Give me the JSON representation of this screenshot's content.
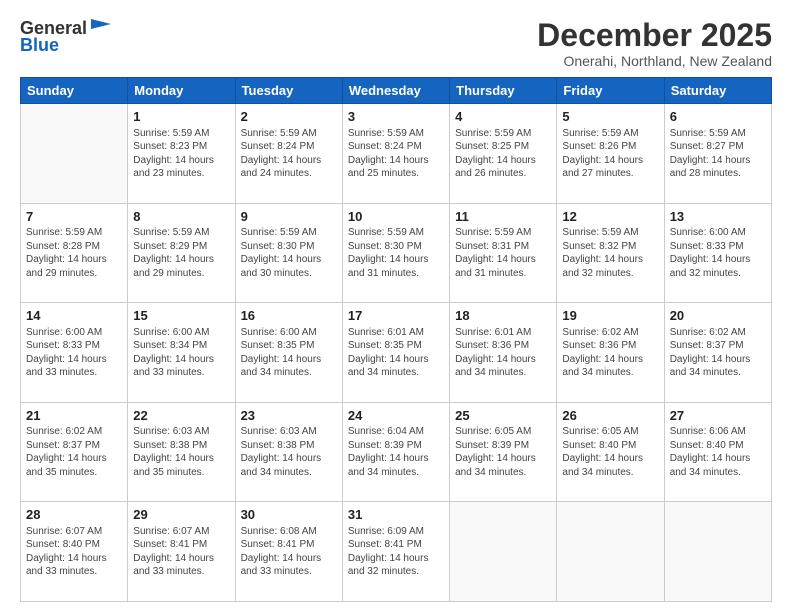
{
  "logo": {
    "general": "General",
    "blue": "Blue"
  },
  "header": {
    "title": "December 2025",
    "location": "Onerahi, Northland, New Zealand"
  },
  "weekdays": [
    "Sunday",
    "Monday",
    "Tuesday",
    "Wednesday",
    "Thursday",
    "Friday",
    "Saturday"
  ],
  "weeks": [
    [
      {
        "day": "",
        "text": ""
      },
      {
        "day": "1",
        "text": "Sunrise: 5:59 AM\nSunset: 8:23 PM\nDaylight: 14 hours\nand 23 minutes."
      },
      {
        "day": "2",
        "text": "Sunrise: 5:59 AM\nSunset: 8:24 PM\nDaylight: 14 hours\nand 24 minutes."
      },
      {
        "day": "3",
        "text": "Sunrise: 5:59 AM\nSunset: 8:24 PM\nDaylight: 14 hours\nand 25 minutes."
      },
      {
        "day": "4",
        "text": "Sunrise: 5:59 AM\nSunset: 8:25 PM\nDaylight: 14 hours\nand 26 minutes."
      },
      {
        "day": "5",
        "text": "Sunrise: 5:59 AM\nSunset: 8:26 PM\nDaylight: 14 hours\nand 27 minutes."
      },
      {
        "day": "6",
        "text": "Sunrise: 5:59 AM\nSunset: 8:27 PM\nDaylight: 14 hours\nand 28 minutes."
      }
    ],
    [
      {
        "day": "7",
        "text": "Sunrise: 5:59 AM\nSunset: 8:28 PM\nDaylight: 14 hours\nand 29 minutes."
      },
      {
        "day": "8",
        "text": "Sunrise: 5:59 AM\nSunset: 8:29 PM\nDaylight: 14 hours\nand 29 minutes."
      },
      {
        "day": "9",
        "text": "Sunrise: 5:59 AM\nSunset: 8:30 PM\nDaylight: 14 hours\nand 30 minutes."
      },
      {
        "day": "10",
        "text": "Sunrise: 5:59 AM\nSunset: 8:30 PM\nDaylight: 14 hours\nand 31 minutes."
      },
      {
        "day": "11",
        "text": "Sunrise: 5:59 AM\nSunset: 8:31 PM\nDaylight: 14 hours\nand 31 minutes."
      },
      {
        "day": "12",
        "text": "Sunrise: 5:59 AM\nSunset: 8:32 PM\nDaylight: 14 hours\nand 32 minutes."
      },
      {
        "day": "13",
        "text": "Sunrise: 6:00 AM\nSunset: 8:33 PM\nDaylight: 14 hours\nand 32 minutes."
      }
    ],
    [
      {
        "day": "14",
        "text": "Sunrise: 6:00 AM\nSunset: 8:33 PM\nDaylight: 14 hours\nand 33 minutes."
      },
      {
        "day": "15",
        "text": "Sunrise: 6:00 AM\nSunset: 8:34 PM\nDaylight: 14 hours\nand 33 minutes."
      },
      {
        "day": "16",
        "text": "Sunrise: 6:00 AM\nSunset: 8:35 PM\nDaylight: 14 hours\nand 34 minutes."
      },
      {
        "day": "17",
        "text": "Sunrise: 6:01 AM\nSunset: 8:35 PM\nDaylight: 14 hours\nand 34 minutes."
      },
      {
        "day": "18",
        "text": "Sunrise: 6:01 AM\nSunset: 8:36 PM\nDaylight: 14 hours\nand 34 minutes."
      },
      {
        "day": "19",
        "text": "Sunrise: 6:02 AM\nSunset: 8:36 PM\nDaylight: 14 hours\nand 34 minutes."
      },
      {
        "day": "20",
        "text": "Sunrise: 6:02 AM\nSunset: 8:37 PM\nDaylight: 14 hours\nand 34 minutes."
      }
    ],
    [
      {
        "day": "21",
        "text": "Sunrise: 6:02 AM\nSunset: 8:37 PM\nDaylight: 14 hours\nand 35 minutes."
      },
      {
        "day": "22",
        "text": "Sunrise: 6:03 AM\nSunset: 8:38 PM\nDaylight: 14 hours\nand 35 minutes."
      },
      {
        "day": "23",
        "text": "Sunrise: 6:03 AM\nSunset: 8:38 PM\nDaylight: 14 hours\nand 34 minutes."
      },
      {
        "day": "24",
        "text": "Sunrise: 6:04 AM\nSunset: 8:39 PM\nDaylight: 14 hours\nand 34 minutes."
      },
      {
        "day": "25",
        "text": "Sunrise: 6:05 AM\nSunset: 8:39 PM\nDaylight: 14 hours\nand 34 minutes."
      },
      {
        "day": "26",
        "text": "Sunrise: 6:05 AM\nSunset: 8:40 PM\nDaylight: 14 hours\nand 34 minutes."
      },
      {
        "day": "27",
        "text": "Sunrise: 6:06 AM\nSunset: 8:40 PM\nDaylight: 14 hours\nand 34 minutes."
      }
    ],
    [
      {
        "day": "28",
        "text": "Sunrise: 6:07 AM\nSunset: 8:40 PM\nDaylight: 14 hours\nand 33 minutes."
      },
      {
        "day": "29",
        "text": "Sunrise: 6:07 AM\nSunset: 8:41 PM\nDaylight: 14 hours\nand 33 minutes."
      },
      {
        "day": "30",
        "text": "Sunrise: 6:08 AM\nSunset: 8:41 PM\nDaylight: 14 hours\nand 33 minutes."
      },
      {
        "day": "31",
        "text": "Sunrise: 6:09 AM\nSunset: 8:41 PM\nDaylight: 14 hours\nand 32 minutes."
      },
      {
        "day": "",
        "text": ""
      },
      {
        "day": "",
        "text": ""
      },
      {
        "day": "",
        "text": ""
      }
    ]
  ]
}
